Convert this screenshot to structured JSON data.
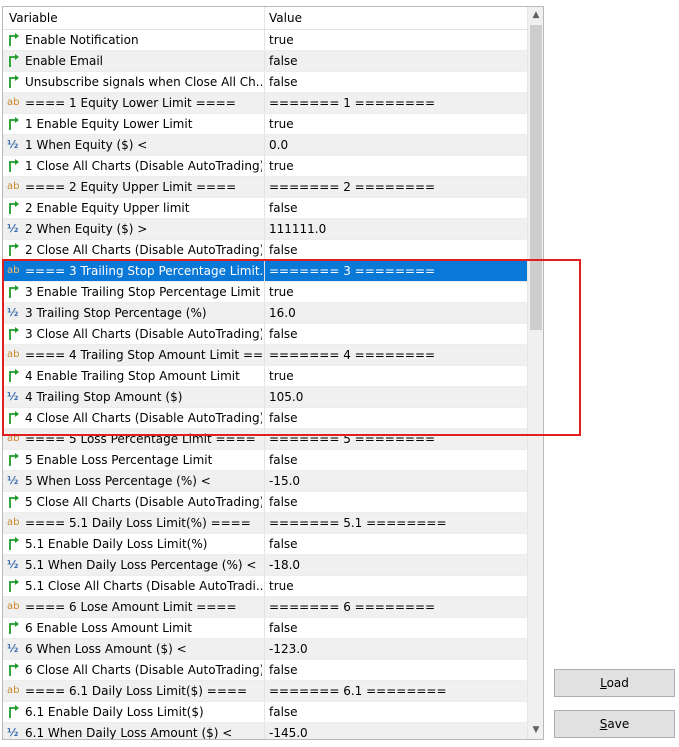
{
  "header": {
    "variable": "Variable",
    "value": "Value"
  },
  "rows": [
    {
      "type": "bool",
      "variable": "Enable Notification",
      "value": "true"
    },
    {
      "type": "bool",
      "variable": "Enable Email",
      "value": "false"
    },
    {
      "type": "bool",
      "variable": "Unsubscribe signals when Close All Ch...",
      "value": "false"
    },
    {
      "type": "string",
      "variable": "==== 1 Equity Lower Limit ====",
      "value": "======= 1 ========"
    },
    {
      "type": "bool",
      "variable": "1 Enable Equity Lower Limit",
      "value": "true"
    },
    {
      "type": "number",
      "variable": "1 When Equity ($) <",
      "value": "0.0"
    },
    {
      "type": "bool",
      "variable": "1 Close All Charts (Disable AutoTrading)",
      "value": "true"
    },
    {
      "type": "string",
      "variable": "==== 2 Equity Upper Limit ====",
      "value": "======= 2 ========"
    },
    {
      "type": "bool",
      "variable": "2 Enable Equity Upper limit",
      "value": "false"
    },
    {
      "type": "number",
      "variable": "2 When Equity ($) >",
      "value": "111111.0"
    },
    {
      "type": "bool",
      "variable": "2 Close All Charts (Disable AutoTrading)",
      "value": "false"
    },
    {
      "type": "string",
      "variable": "==== 3 Trailing Stop Percentage Limit...",
      "value": "======= 3 ========",
      "selected": true
    },
    {
      "type": "bool",
      "variable": "3 Enable Trailing Stop Percentage Limit",
      "value": "true"
    },
    {
      "type": "number",
      "variable": "3 Trailing Stop Percentage (%)",
      "value": "16.0"
    },
    {
      "type": "bool",
      "variable": "3 Close All Charts (Disable AutoTrading)",
      "value": "false"
    },
    {
      "type": "string",
      "variable": "==== 4 Trailing Stop Amount Limit ==...",
      "value": "======= 4 ========"
    },
    {
      "type": "bool",
      "variable": "4 Enable Trailing Stop Amount Limit",
      "value": "true"
    },
    {
      "type": "number",
      "variable": "4 Trailing Stop Amount ($)",
      "value": "105.0"
    },
    {
      "type": "bool",
      "variable": "4 Close All Charts (Disable AutoTrading)",
      "value": "false"
    },
    {
      "type": "string",
      "variable": "==== 5 Loss Percentage Limit ====",
      "value": "======= 5 ========"
    },
    {
      "type": "bool",
      "variable": "5 Enable Loss Percentage Limit",
      "value": "false"
    },
    {
      "type": "number",
      "variable": "5 When Loss Percentage (%) <",
      "value": "-15.0"
    },
    {
      "type": "bool",
      "variable": "5 Close All Charts (Disable AutoTrading)",
      "value": "false"
    },
    {
      "type": "string",
      "variable": "==== 5.1 Daily Loss Limit(%) ====",
      "value": "======= 5.1 ========"
    },
    {
      "type": "bool",
      "variable": "5.1 Enable Daily Loss Limit(%)",
      "value": "false"
    },
    {
      "type": "number",
      "variable": "5.1 When Daily Loss Percentage (%) <",
      "value": "-18.0"
    },
    {
      "type": "bool",
      "variable": "5.1 Close All Charts (Disable AutoTradi...",
      "value": "true"
    },
    {
      "type": "string",
      "variable": "==== 6 Lose Amount Limit ====",
      "value": "======= 6 ========"
    },
    {
      "type": "bool",
      "variable": "6 Enable Loss Amount Limit",
      "value": "false"
    },
    {
      "type": "number",
      "variable": "6 When Loss Amount ($) <",
      "value": "-123.0"
    },
    {
      "type": "bool",
      "variable": "6 Close All Charts (Disable AutoTrading)",
      "value": "false"
    },
    {
      "type": "string",
      "variable": "==== 6.1 Daily Loss Limit($) ====",
      "value": "======= 6.1 ========"
    },
    {
      "type": "bool",
      "variable": "6.1 Enable Daily Loss Limit($)",
      "value": "false"
    },
    {
      "type": "number",
      "variable": "6.1 When Daily Loss Amount ($) <",
      "value": "-145.0"
    }
  ],
  "icons": {
    "bool": "arrow-icon",
    "string": "ab-icon",
    "number": "fraction-icon"
  },
  "colors": {
    "selected_row": "#0a78d7",
    "highlight_border": "#e02020"
  },
  "buttons": {
    "load": {
      "first": "L",
      "rest": "oad"
    },
    "save": {
      "first": "S",
      "rest": "ave"
    }
  }
}
